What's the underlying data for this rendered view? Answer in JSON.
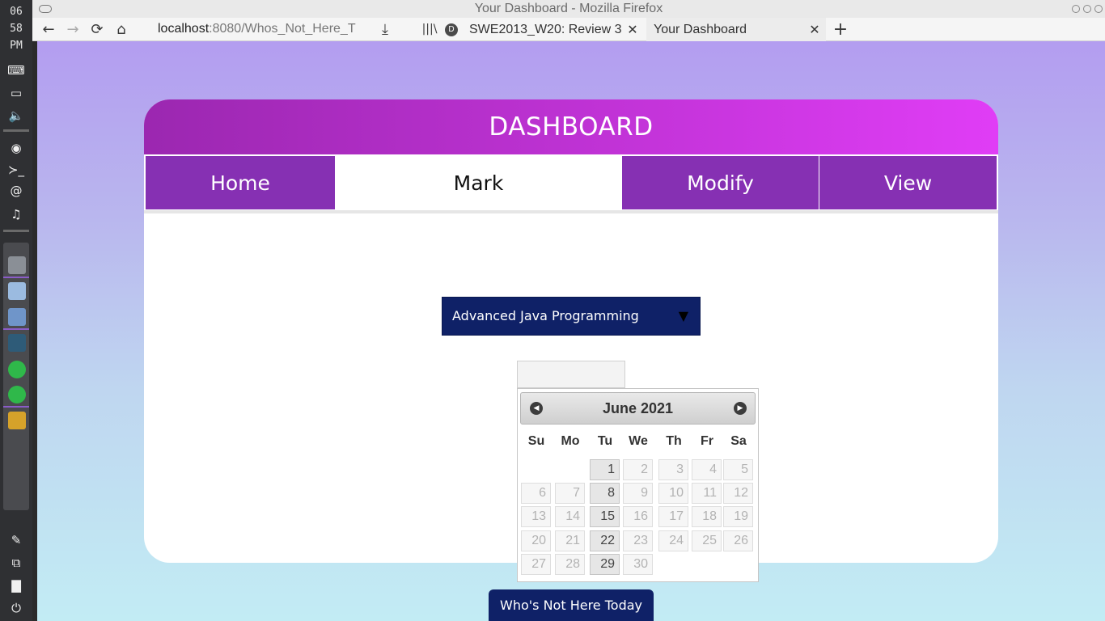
{
  "os": {
    "clock_lines": [
      "06",
      "58",
      "PM"
    ]
  },
  "browser": {
    "window_title": "Your Dashboard - Mozilla Firefox",
    "url_host": "localhost",
    "url_rest": ":8080/Whos_Not_Here_T",
    "tabs": [
      {
        "label": "SWE2013_W20: Review 3",
        "active": false,
        "favicon": "D"
      },
      {
        "label": "Your Dashboard",
        "active": true
      }
    ],
    "icons": {
      "back": "←",
      "forward": "→",
      "reload": "⟳",
      "home": "⌂",
      "download": "⤓",
      "library": "|||\\",
      "new_tab": "+",
      "close": "✕"
    }
  },
  "page": {
    "header_title": "DASHBOARD",
    "nav": [
      {
        "label": "Home",
        "active": false
      },
      {
        "label": "Mark",
        "active": true
      },
      {
        "label": "Modify",
        "active": false
      },
      {
        "label": "View",
        "active": false
      }
    ],
    "course_select": {
      "selected": "Advanced Java Programming"
    },
    "date_input": {
      "value": ""
    },
    "datepicker": {
      "month_label": "June 2021",
      "weekdays": [
        "Su",
        "Mo",
        "Tu",
        "We",
        "Th",
        "Fr",
        "Sa"
      ],
      "enabled_days": [
        1,
        8,
        15,
        22,
        29
      ],
      "first_weekday": 2,
      "days_in_month": 30
    },
    "absent_button_label": "Who's Not Here Today"
  }
}
